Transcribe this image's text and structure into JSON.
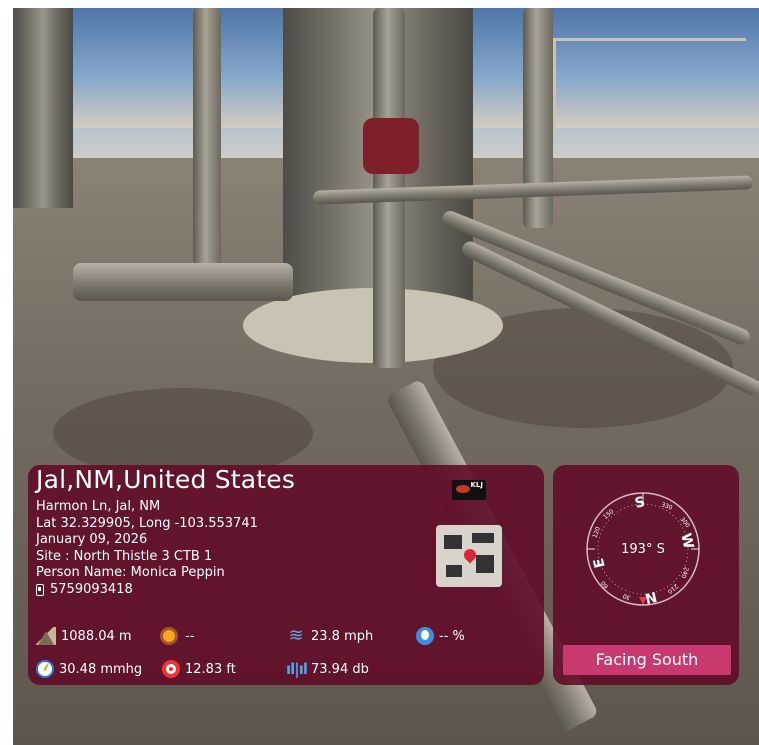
{
  "photo": {
    "description_icon": "industrial-site-photo"
  },
  "info": {
    "location_title": "Jal,NM,United States",
    "address": "Harmon Ln, Jal, NM",
    "coordinates": "Lat 32.329905, Long -103.553741",
    "date": "January 09, 2026",
    "site": "Site : North Thistle 3 CTB 1",
    "person": "Person Name: Monica Peppin",
    "phone": "5759093418",
    "logo_text": "KLJ"
  },
  "metrics": {
    "altitude": "1088.04 m",
    "weather": "--",
    "wind": "23.8 mph",
    "humidity": "-- %",
    "pressure": "30.48 mmhg",
    "accuracy": "12.83 ft",
    "sound": "73.94 db"
  },
  "compass": {
    "heading": "193° S",
    "cardinal_n": "N",
    "cardinal_s": "S",
    "cardinal_e": "E",
    "cardinal_w": "W",
    "tick_labels": [
      "330",
      "300",
      "240",
      "210",
      "150",
      "120",
      "60",
      "30"
    ],
    "facing_label": "Facing South"
  },
  "colors": {
    "card_bg": "#600c28",
    "button_bg": "#c83a6f",
    "accent_blue": "#3c8fe0"
  }
}
